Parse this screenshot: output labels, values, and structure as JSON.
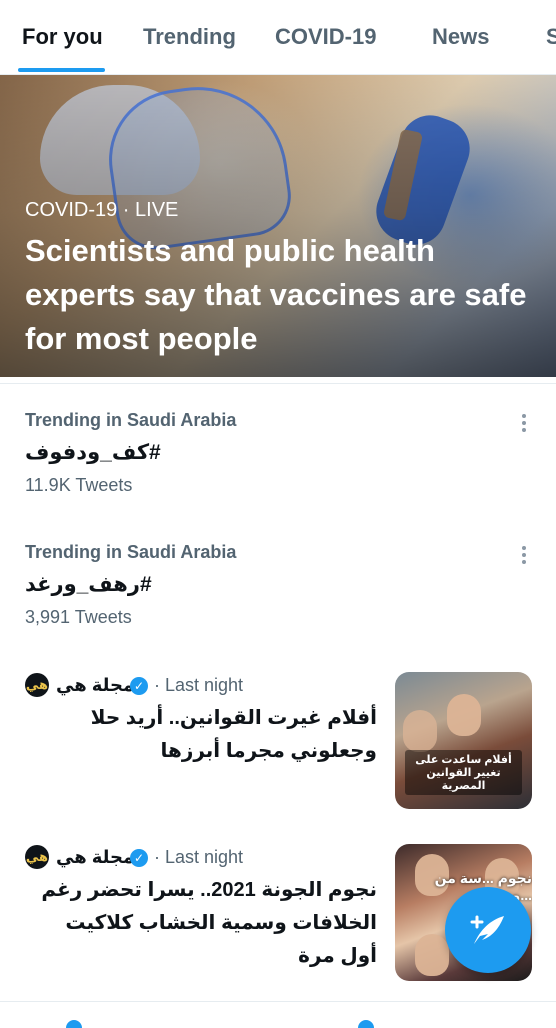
{
  "tabs": [
    {
      "label": "For you",
      "active": true
    },
    {
      "label": "Trending"
    },
    {
      "label": "COVID-19"
    },
    {
      "label": "News"
    },
    {
      "label": "S"
    }
  ],
  "hero": {
    "category": "COVID-19 · LIVE",
    "title": "Scientists and public health experts say that vaccines are safe for most people"
  },
  "trends": [
    {
      "context": "Trending in Saudi Arabia",
      "name": "#كف_ودفوف",
      "count": "11.9K Tweets"
    },
    {
      "context": "Trending in Saudi Arabia",
      "name": "#رهف_ورغد",
      "count": "3,991 Tweets"
    }
  ],
  "news": [
    {
      "source": "مجلة هي",
      "avatar_text": "هي",
      "time": "· Last night",
      "title": "أفلام غيرت القوانين.. أريد حلا وجعلوني مجرما أبرزها",
      "thumb_caption": "أفلام ساعدت على تغيير القوانين المصرية"
    },
    {
      "source": "مجلة هي",
      "avatar_text": "هي",
      "time": "· Last night",
      "title": "نجوم الجونة 2021.. يسرا تحضر رغم الخلافات وسمية الخشاب كلاكيت أول مرة",
      "thumb_caption": "نجوم ...سة من ...ونة"
    }
  ],
  "icons": {
    "more": "more-vertical-icon",
    "verified": "verified-badge-icon",
    "compose": "compose-tweet-icon"
  },
  "colors": {
    "accent": "#1d9bf0",
    "text_primary": "#0f1419",
    "text_secondary": "#536471"
  }
}
